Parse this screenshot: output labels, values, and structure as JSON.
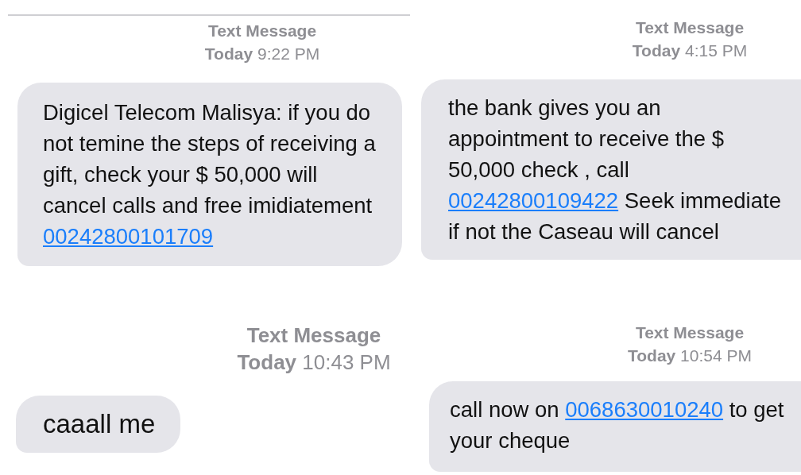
{
  "panels": [
    {
      "label": "Text Message",
      "day": "Today",
      "time": "9:22 PM",
      "message": [
        {
          "kind": "text",
          "text": "Digicel Telecom Malisya: if you do not temine the steps of receiving a gift, check your $ 50,000 will cancel calls and free imidiatement "
        },
        {
          "kind": "link",
          "text": "00242800101709"
        }
      ]
    },
    {
      "label": "Text Message",
      "day": "Today",
      "time": "4:15 PM",
      "message": [
        {
          "kind": "text",
          "text": "the bank gives you an appointment to receive the $ 50,000 check , call "
        },
        {
          "kind": "link",
          "text": "00242800109422"
        },
        {
          "kind": "text",
          "text": " Seek immediate if not the Caseau will cancel"
        }
      ]
    },
    {
      "label": "Text Message",
      "day": "Today",
      "time": "10:43 PM",
      "message": [
        {
          "kind": "text",
          "text": "caaall me"
        }
      ]
    },
    {
      "label": "Text Message",
      "day": "Today",
      "time": "10:54 PM",
      "message": [
        {
          "kind": "text",
          "text": "call now on "
        },
        {
          "kind": "link",
          "text": "0068630010240"
        },
        {
          "kind": "text",
          "text": " to get your cheque"
        }
      ]
    }
  ]
}
